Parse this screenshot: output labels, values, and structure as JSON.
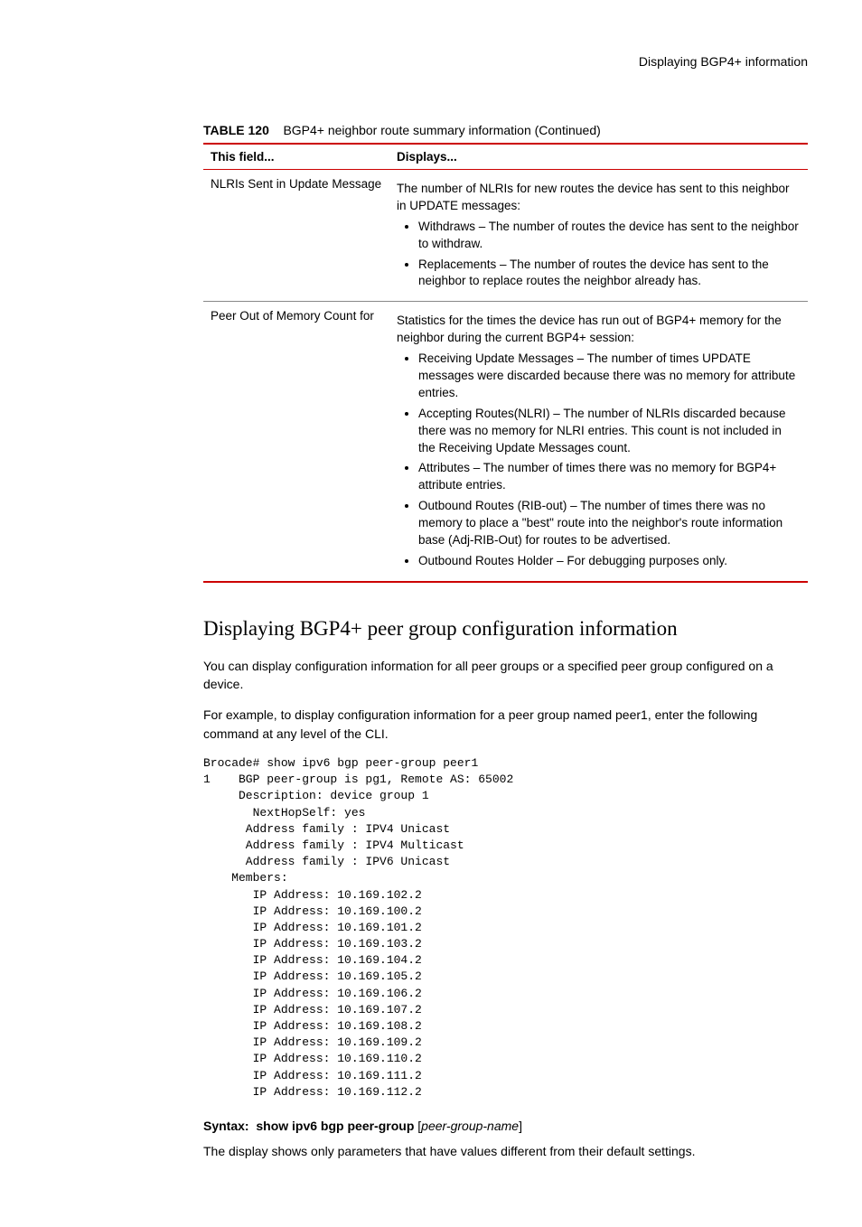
{
  "header": {
    "running_title": "Displaying BGP4+ information"
  },
  "table": {
    "caption_prefix": "TABLE 120",
    "caption_text": "BGP4+ neighbor route summary information  (Continued)",
    "headers": {
      "field": "This field...",
      "displays": "Displays..."
    },
    "rows": [
      {
        "field": "NLRIs Sent in Update Message",
        "intro": "The number of NLRIs for new routes the device has sent to this neighbor in UPDATE messages:",
        "bullets": [
          "Withdraws – The number of routes the device has sent to the neighbor to withdraw.",
          "Replacements – The number of routes the device has sent to the neighbor to replace routes the neighbor already has."
        ]
      },
      {
        "field": "Peer Out of Memory Count for",
        "intro": "Statistics for the times the device has run out of BGP4+ memory for the neighbor during the current BGP4+ session:",
        "bullets": [
          "Receiving Update Messages – The number of times UPDATE messages were discarded because there was no memory for attribute entries.",
          "Accepting Routes(NLRI) – The number of NLRIs discarded because there was no memory for NLRI entries.  This count is not included in the Receiving Update Messages count.",
          "Attributes – The number of times there was no memory for BGP4+ attribute entries.",
          "Outbound Routes (RIB-out) – The number of times there was no memory to place a \"best\" route into the neighbor's route information base (Adj-RIB-Out) for routes to be advertised.",
          "Outbound Routes Holder – For debugging purposes only."
        ]
      }
    ]
  },
  "section": {
    "title": "Displaying BGP4+ peer group configuration information",
    "para1": "You can display configuration information for all peer groups or a specified peer group configured on a device.",
    "para2": "For example, to display configuration information for a peer group named peer1, enter the following command at any level of the CLI.",
    "code": "Brocade# show ipv6 bgp peer-group peer1\n1    BGP peer-group is pg1, Remote AS: 65002\n     Description: device group 1\n       NextHopSelf: yes\n      Address family : IPV4 Unicast\n      Address family : IPV4 Multicast\n      Address family : IPV6 Unicast\n    Members:\n       IP Address: 10.169.102.2\n       IP Address: 10.169.100.2\n       IP Address: 10.169.101.2\n       IP Address: 10.169.103.2\n       IP Address: 10.169.104.2\n       IP Address: 10.169.105.2\n       IP Address: 10.169.106.2\n       IP Address: 10.169.107.2\n       IP Address: 10.169.108.2\n       IP Address: 10.169.109.2\n       IP Address: 10.169.110.2\n       IP Address: 10.169.111.2\n       IP Address: 10.169.112.2",
    "syntax_label": "Syntax:",
    "syntax_cmd": "show ipv6 bgp peer-group",
    "syntax_open_bracket": "[",
    "syntax_param": "peer-group-name",
    "syntax_close_bracket": "]",
    "para3": "The display shows only parameters that have values different from their default settings."
  }
}
